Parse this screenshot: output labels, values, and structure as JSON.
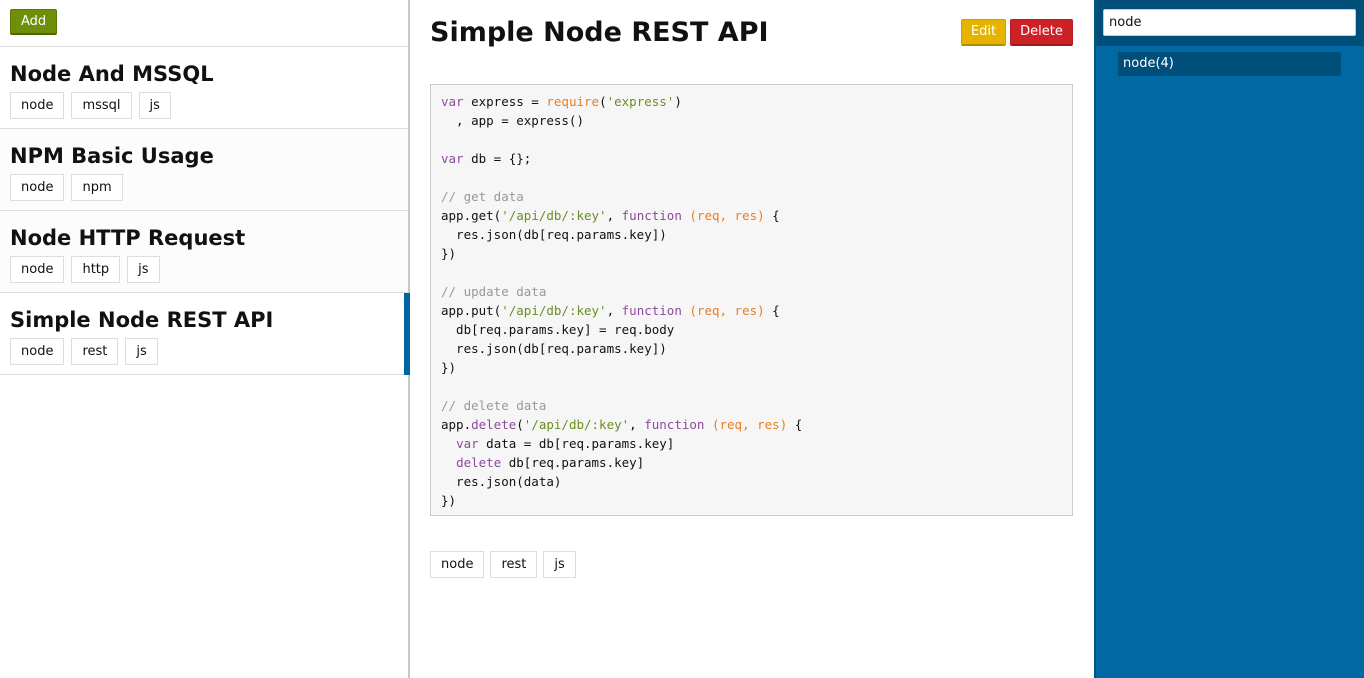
{
  "left": {
    "add_label": "Add",
    "snippets": [
      {
        "title": "Node And MSSQL",
        "tags": [
          "node",
          "mssql",
          "js"
        ]
      },
      {
        "title": "NPM Basic Usage",
        "tags": [
          "node",
          "npm"
        ]
      },
      {
        "title": "Node HTTP Request",
        "tags": [
          "node",
          "http",
          "js"
        ]
      },
      {
        "title": "Simple Node REST API",
        "tags": [
          "node",
          "rest",
          "js"
        ]
      }
    ]
  },
  "main": {
    "title": "Simple Node REST API",
    "edit_label": "Edit",
    "delete_label": "Delete",
    "tags": [
      "node",
      "rest",
      "js"
    ],
    "code_lines": [
      "var express = require('express')",
      "  , app = express()",
      "",
      "var db = {};",
      "",
      "// get data",
      "app.get('/api/db/:key', function (req, res) {",
      "  res.json(db[req.params.key])",
      "})",
      "",
      "// update data",
      "app.put('/api/db/:key', function (req, res) {",
      "  db[req.params.key] = req.body",
      "  res.json(db[req.params.key])",
      "})",
      "",
      "// delete data",
      "app.delete('/api/db/:key', function (req, res) {",
      "  var data = db[req.params.key]",
      "  delete db[req.params.key]",
      "  res.json(data)",
      "})"
    ]
  },
  "sidebar": {
    "search_value": "node",
    "result_label": "node(4)"
  },
  "colors": {
    "add_button": "#6e8f0a",
    "edit_button": "#e6b400",
    "delete_button": "#cc2127",
    "sidebar_bg": "#0069a4",
    "active_indicator": "#0066a1"
  }
}
